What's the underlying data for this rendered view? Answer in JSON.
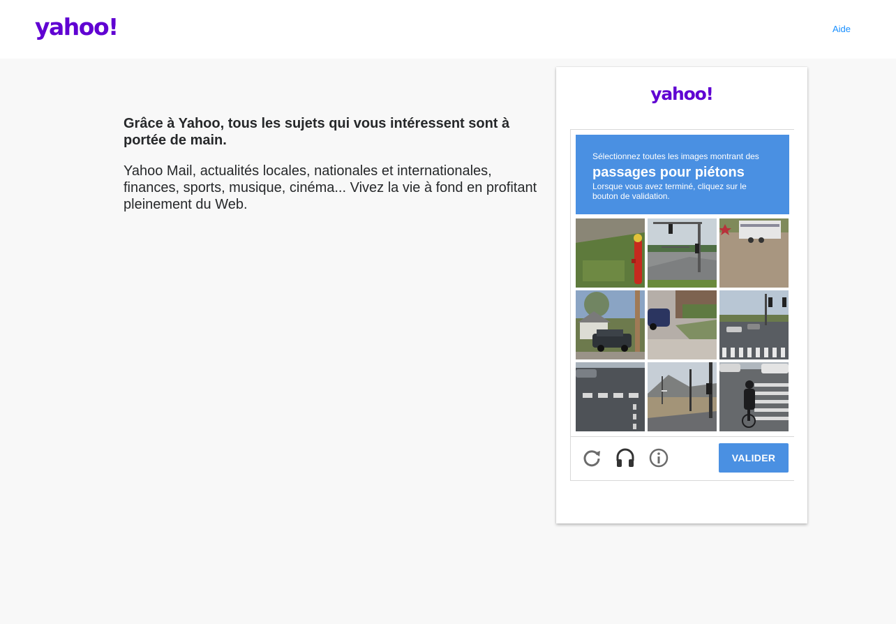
{
  "header": {
    "logo_text": "yahoo!",
    "help_label": "Aide"
  },
  "promo": {
    "title": "Grâce à Yahoo, tous les sujets qui vous intéressent sont à portée de main.",
    "body": "Yahoo Mail, actualités locales, nationales et internationales, finances, sports, musique, cinéma... Vivez la vie à fond en profitant pleinement du Web."
  },
  "card": {
    "logo_text": "yahoo!"
  },
  "captcha": {
    "instruction": "Sélectionnez toutes les images montrant des",
    "target": "passages pour piétons",
    "hint": "Lorsque vous avez terminé, cliquez sur le bouton de validation.",
    "tiles": [
      {
        "icon": "grass-hydrant-tile"
      },
      {
        "icon": "traffic-light-road-tile"
      },
      {
        "icon": "trailer-lot-tile"
      },
      {
        "icon": "house-car-tile"
      },
      {
        "icon": "driveway-car-tile"
      },
      {
        "icon": "crosswalk-road-tile"
      },
      {
        "icon": "crosswalk-intersection-tile"
      },
      {
        "icon": "mountain-road-tile"
      },
      {
        "icon": "cyclist-crosswalk-tile"
      }
    ],
    "controls": {
      "reload_icon": "reload-icon",
      "audio_icon": "headphones-icon",
      "info_icon": "info-icon",
      "validate_label": "VALIDER"
    }
  },
  "colors": {
    "brand": "#6001d2",
    "captcha_blue": "#4a90e2",
    "link": "#188fff"
  }
}
